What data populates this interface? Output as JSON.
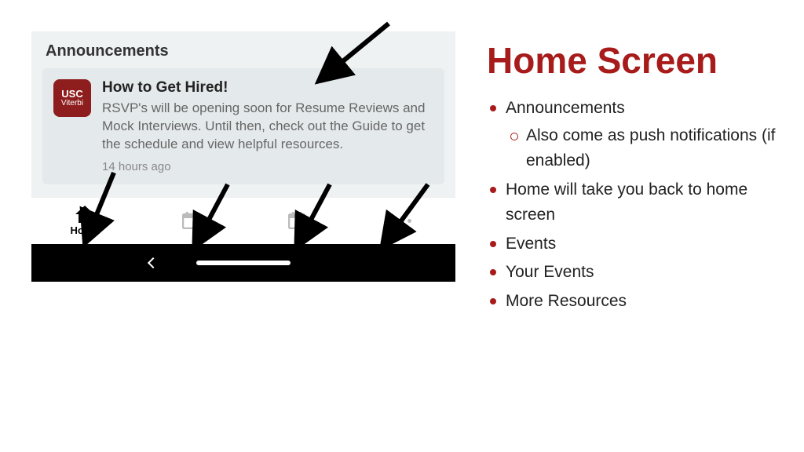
{
  "slide": {
    "title": "Home Screen",
    "bullets": [
      {
        "text": "Announcements",
        "sub": [
          {
            "text": "Also come as push notifications (if enabled)"
          }
        ]
      },
      {
        "text": "Home will take you back to home screen"
      },
      {
        "text": "Events"
      },
      {
        "text": "Your Events"
      },
      {
        "text": "More Resources"
      }
    ]
  },
  "phone": {
    "section_header": "Announcements",
    "app_icon": {
      "line1": "USC",
      "line2": "Viterbi"
    },
    "card": {
      "title": "How to Get Hired!",
      "body": "RSVP's will be opening soon for Resume Reviews and Mock Interviews. Until then, check out the Guide to get the schedule and view helpful resources.",
      "time": "14 hours ago"
    },
    "tabs": {
      "home_label": "Home"
    }
  }
}
